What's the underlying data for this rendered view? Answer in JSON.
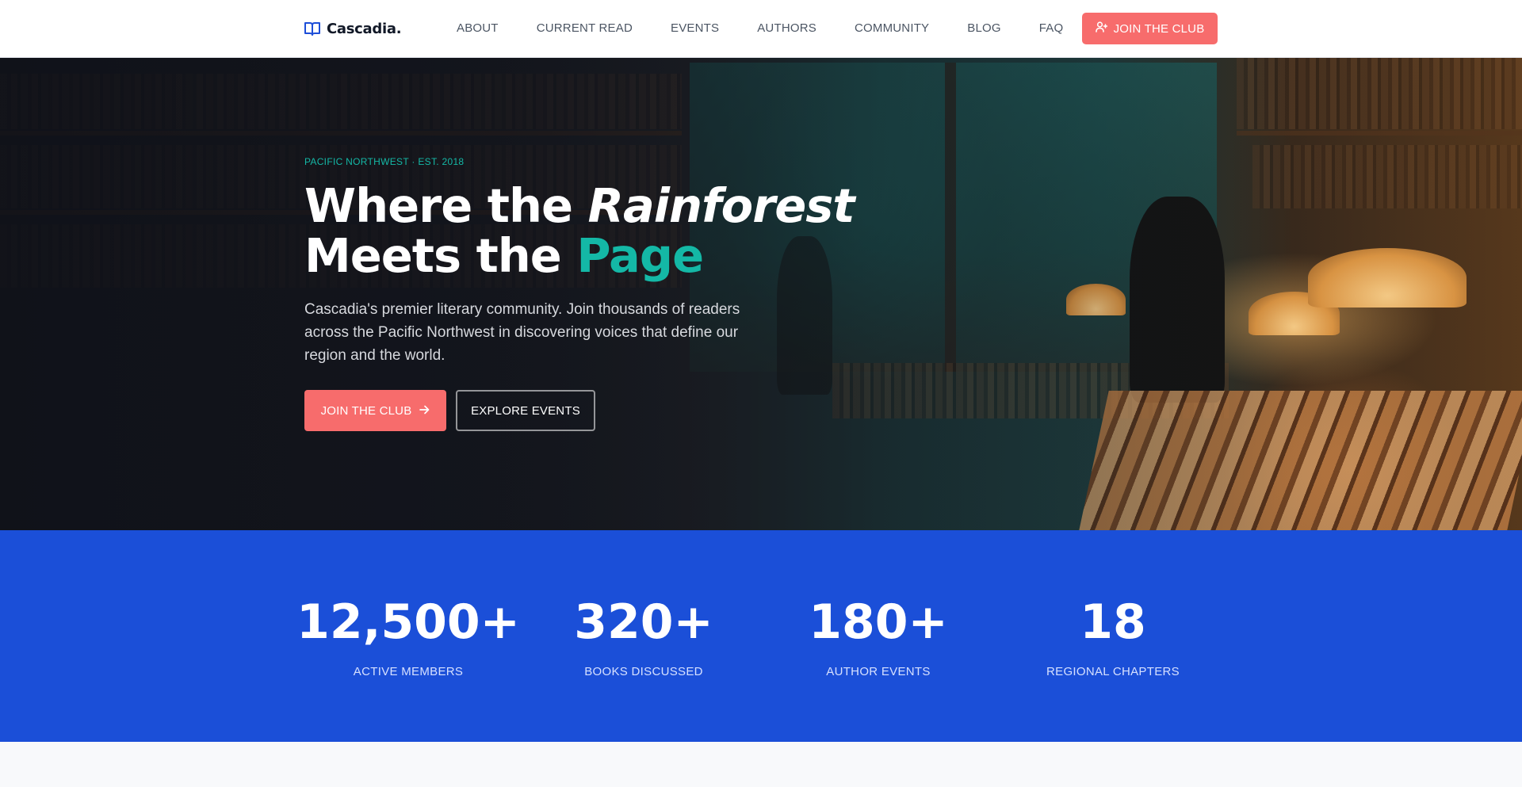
{
  "brand": {
    "name": "Cascadia.",
    "icon": "book-open-icon"
  },
  "nav": {
    "links": [
      "ABOUT",
      "CURRENT READ",
      "EVENTS",
      "AUTHORS",
      "COMMUNITY",
      "BLOG",
      "FAQ"
    ],
    "cta_label": "JOIN THE CLUB",
    "cta_icon": "user-plus-icon"
  },
  "hero": {
    "eyebrow": "PACIFIC NORTHWEST · EST. 2018",
    "headline": {
      "line1_a": "Where the ",
      "line1_b": "Rainforest",
      "line2_a": "Meets the ",
      "line2_b": "Page"
    },
    "lede": "Cascadia's premier literary community. Join thousands of readers across the Pacific Northwest in discovering voices that define our region and the world.",
    "primary_button": "JOIN THE CLUB",
    "primary_icon": "arrow-right-icon",
    "secondary_button": "EXPLORE EVENTS"
  },
  "stats": [
    {
      "value": "12,500+",
      "label": "ACTIVE MEMBERS"
    },
    {
      "value": "320+",
      "label": "BOOKS DISCUSSED"
    },
    {
      "value": "180+",
      "label": "AUTHOR EVENTS"
    },
    {
      "value": "18",
      "label": "REGIONAL CHAPTERS"
    }
  ],
  "colors": {
    "accent_coral": "#f76c6c",
    "accent_teal": "#14b8a6",
    "stats_blue": "#1b4fd8",
    "brand_icon": "#1d4ed8"
  }
}
